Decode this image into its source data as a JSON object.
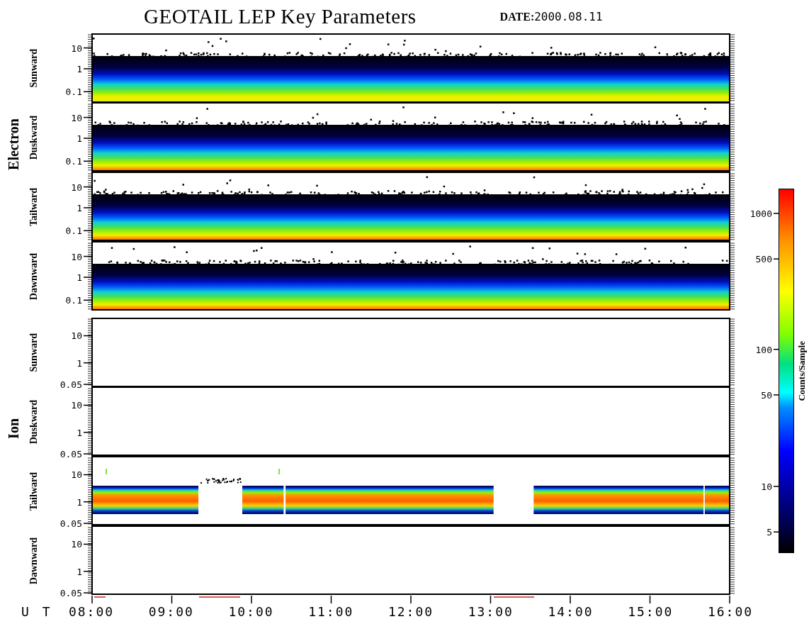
{
  "title": "GEOTAIL LEP Key Parameters",
  "date": {
    "label": "DATE:",
    "value": "2000.08.11"
  },
  "groups": [
    {
      "name": "Electron",
      "panels": [
        {
          "direction": "Sunward",
          "kind": "spectrum",
          "yticks": [
            "10",
            "1",
            "0.1"
          ]
        },
        {
          "direction": "Duskward",
          "kind": "spectrum",
          "yticks": [
            "10",
            "1",
            "0.1"
          ]
        },
        {
          "direction": "Tailward",
          "kind": "spectrum",
          "yticks": [
            "10",
            "1",
            "0.1"
          ]
        },
        {
          "direction": "Dawnward",
          "kind": "spectrum",
          "yticks": [
            "10",
            "1",
            "0.1"
          ]
        }
      ]
    },
    {
      "name": "Ion",
      "panels": [
        {
          "direction": "Sunward",
          "kind": "empty",
          "yticks": [
            "10",
            "1",
            "0.05"
          ]
        },
        {
          "direction": "Duskward",
          "kind": "empty",
          "yticks": [
            "10",
            "1",
            "0.05"
          ]
        },
        {
          "direction": "Tailward",
          "kind": "band",
          "yticks": [
            "10",
            "1",
            "0.05"
          ]
        },
        {
          "direction": "Dawnward",
          "kind": "empty",
          "yticks": [
            "10",
            "1",
            "0.05"
          ]
        }
      ]
    }
  ],
  "time_axis": {
    "label": "U T",
    "ticks": [
      "08:00",
      "09:00",
      "10:00",
      "11:00",
      "12:00",
      "13:00",
      "14:00",
      "15:00",
      "16:00"
    ]
  },
  "colorbar": {
    "title": "Counts/Sample",
    "ticks": [
      "1000",
      "500",
      "100",
      "50",
      "10",
      "5"
    ]
  }
}
